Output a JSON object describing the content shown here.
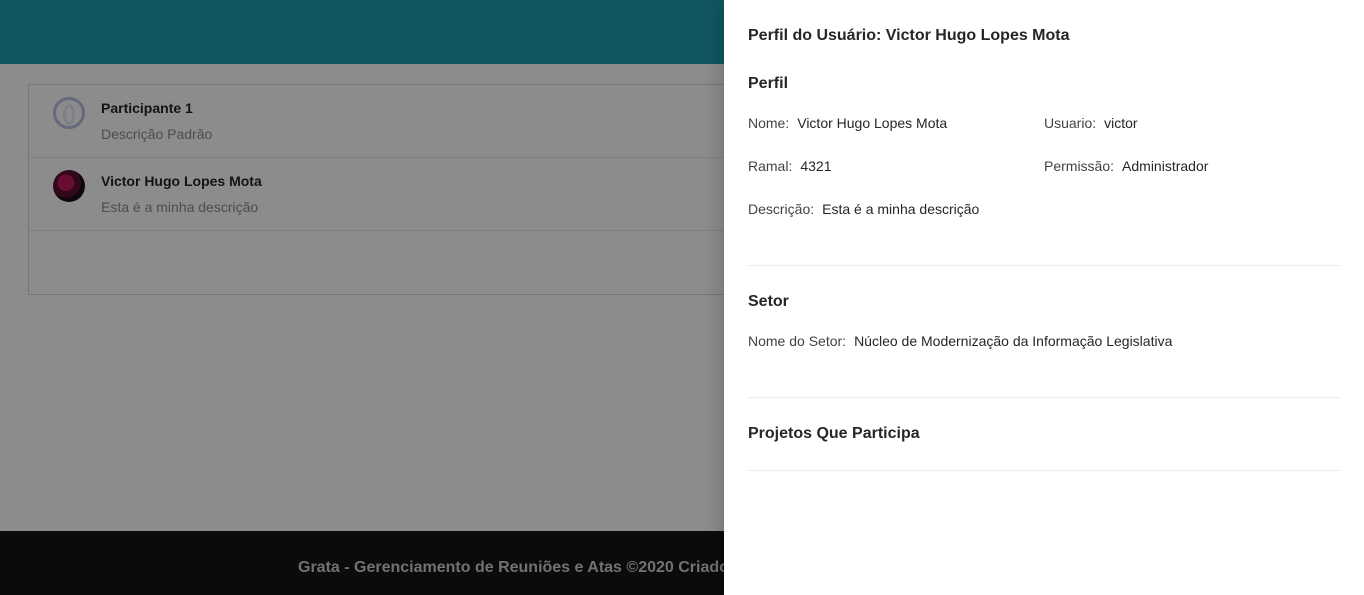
{
  "background": {
    "participants": [
      {
        "name": "Participante 1",
        "description": "Descrição Padrão",
        "avatar": "default-user-icon"
      },
      {
        "name": "Victor Hugo Lopes Mota",
        "description": "Esta é a minha descrição",
        "avatar": "user-photo"
      }
    ],
    "footer_text": "Grata - Gerenciamento de Reuniões e Atas ©2020 Criado"
  },
  "drawer": {
    "title": "Perfil do Usuário: Victor Hugo Lopes Mota",
    "perfil": {
      "heading": "Perfil",
      "nome_label": "Nome:",
      "nome_value": "Victor Hugo Lopes Mota",
      "usuario_label": "Usuario:",
      "usuario_value": "victor",
      "ramal_label": "Ramal:",
      "ramal_value": "4321",
      "permissao_label": "Permissão:",
      "permissao_value": "Administrador",
      "descricao_label": "Descrição:",
      "descricao_value": "Esta é a minha descrição"
    },
    "setor": {
      "heading": "Setor",
      "nome_label": "Nome do Setor:",
      "nome_value": "Núcleo de Modernização da Informação Legislativa"
    },
    "projetos": {
      "heading": "Projetos Que Participa"
    }
  }
}
